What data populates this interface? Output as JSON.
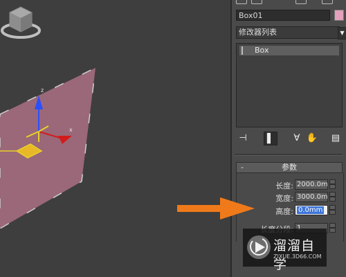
{
  "object": {
    "name": "Box01",
    "color": "#e3a1bc"
  },
  "modifier_list": {
    "selected": "修改器列表",
    "arrow_icon": "chevron-down-icon"
  },
  "modifier_stack": {
    "items": [
      {
        "label": "Box"
      }
    ]
  },
  "stack_toolbar": {
    "icons": [
      "pin-stack-icon",
      "show-end-result-icon",
      "make-unique-icon",
      "remove-modifier-icon",
      "configure-modifier-sets-icon"
    ]
  },
  "rollout": {
    "collapse_symbol": "-",
    "title": "参数",
    "params": [
      {
        "label": "长度:",
        "value": "2000.0mm",
        "selected": false
      },
      {
        "label": "宽度:",
        "value": "3000.0mm",
        "selected": false
      },
      {
        "label": "高度:",
        "value": "0.0mm",
        "selected": true
      },
      {
        "label": "长度分段:",
        "value": "1",
        "selected": false
      }
    ]
  },
  "viewport": {
    "axis_labels": {
      "x": "x",
      "y": "y",
      "z": "z"
    },
    "plane_color": "#9a6878"
  },
  "annotation": {
    "arrow_color": "#f07a1a"
  },
  "watermark": {
    "title": "溜溜自学",
    "url": "ZIXUE.3D66.COM"
  }
}
